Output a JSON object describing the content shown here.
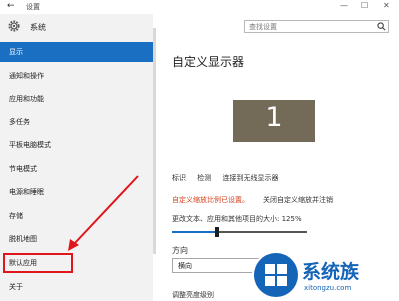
{
  "window": {
    "title": "设置",
    "back_icon": "arrow-left-icon",
    "minimize": "—",
    "maximize": "☐",
    "close": "✕"
  },
  "sidebar": {
    "header_label": "系统",
    "items": [
      {
        "label": "显示",
        "selected": true
      },
      {
        "label": "通知和操作"
      },
      {
        "label": "应用和功能"
      },
      {
        "label": "多任务"
      },
      {
        "label": "平板电脑模式"
      },
      {
        "label": "节电模式"
      },
      {
        "label": "电源和睡眠"
      },
      {
        "label": "存储"
      },
      {
        "label": "脱机地图"
      },
      {
        "label": "默认应用",
        "highlighted": true
      },
      {
        "label": "关于"
      }
    ]
  },
  "search": {
    "placeholder": "查找设置"
  },
  "main": {
    "title": "自定义显示器",
    "monitor_number": "1",
    "links": [
      "标识",
      "检测",
      "连接到无线显示器"
    ],
    "warning": "自定义缩放比例已设置。",
    "warning_link": "关闭自定义缩放并注销",
    "scale_label": "更改文本、应用和其他项目的大小: 125%",
    "scale_value": 125,
    "scale_min": 100,
    "scale_max": 175,
    "orientation_label": "方向",
    "orientation_value": "横向",
    "brightness_label": "调整亮度级别"
  },
  "watermark": {
    "brand": "系统族",
    "url": "xitongzu.com"
  },
  "colors": {
    "accent": "#1a6fc2",
    "annotation_red": "#e0161d",
    "monitor": "#736b58",
    "warning": "#d5401c"
  }
}
